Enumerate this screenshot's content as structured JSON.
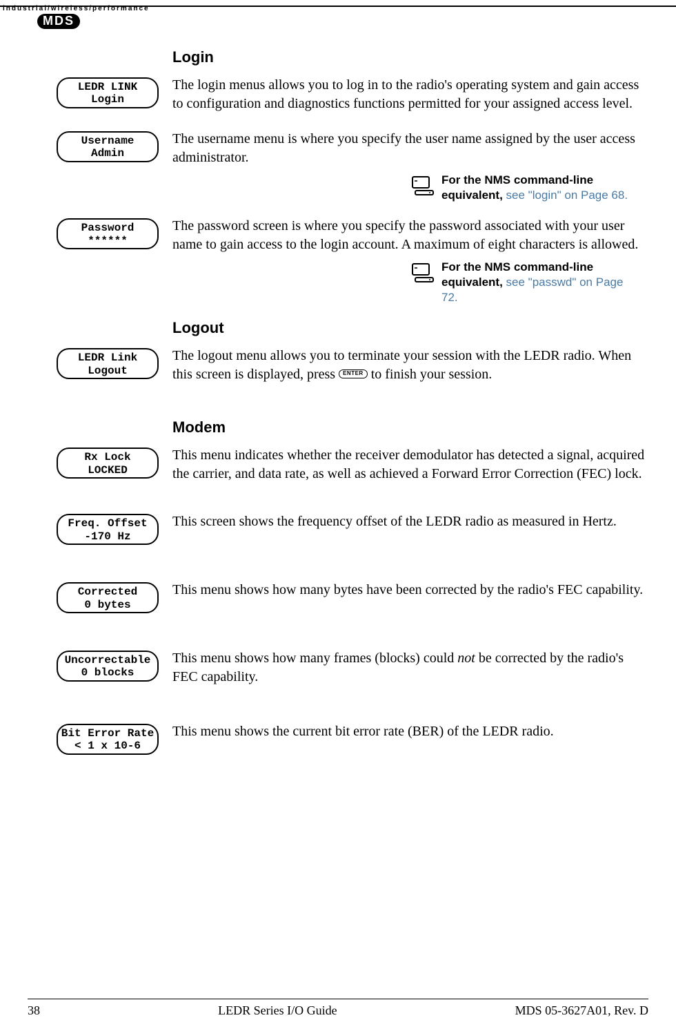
{
  "header": {
    "tagline": "industrial/wireless/performance",
    "brand": "MDS"
  },
  "sections": {
    "login": {
      "title": "Login",
      "items": [
        {
          "lcd1": "LEDR LINK",
          "lcd2": "Login",
          "text": "The login menus allows you to log in to the radio's operating system and gain access to configuration and diagnostics functions permitted for your assigned access level."
        },
        {
          "lcd1": "Username",
          "lcd2": "Admin",
          "text": "The username menu is where you specify the user name assigned by the user access administrator.",
          "ref_bold": "For the NMS command-line equivalent, ",
          "ref_link": "see \"login\" on Page 68",
          "ref_tail": "."
        },
        {
          "lcd1": "Password",
          "lcd2": "******",
          "text": "The password screen is where you specify the password associated with your user name to gain access to the login account. A maximum of eight characters is allowed.",
          "ref_bold": "For the NMS command-line equivalent, ",
          "ref_link": "see \"passwd\" on Page 72",
          "ref_tail": "."
        }
      ]
    },
    "logout": {
      "title": "Logout",
      "items": [
        {
          "lcd1": "LEDR Link",
          "lcd2": "Logout",
          "text_pre": "The logout menu allows you to terminate your session with the LEDR radio. When this screen is displayed, press ",
          "enter_label": "ENTER",
          "text_post": " to finish your session."
        }
      ]
    },
    "modem": {
      "title": "Modem",
      "items": [
        {
          "lcd1": "Rx Lock",
          "lcd2": "LOCKED",
          "text": "This menu indicates whether the receiver demodulator has detected a signal, acquired the carrier, and data rate, as well as achieved a Forward Error Correction (FEC) lock."
        },
        {
          "lcd1": "Freq. Offset",
          "lcd2": "-170 Hz",
          "text": "This screen shows the frequency offset of the LEDR radio as measured in Hertz."
        },
        {
          "lcd1": "Corrected",
          "lcd2": "0 bytes",
          "text": "This menu shows how many bytes have been corrected by the radio's FEC capability."
        },
        {
          "lcd1": "Uncorrectable",
          "lcd2": "0 blocks",
          "text_pre": "This menu shows how many frames (blocks) could ",
          "text_italic": "not",
          "text_post": " be corrected by the radio's FEC capability."
        },
        {
          "lcd1": "Bit Error Rate",
          "lcd2": "< 1 x 10-6",
          "text": "This menu shows the current bit error rate (BER) of the LEDR radio."
        }
      ]
    }
  },
  "footer": {
    "page": "38",
    "center": "LEDR Series I/O Guide",
    "right": "MDS 05-3627A01, Rev. D"
  }
}
